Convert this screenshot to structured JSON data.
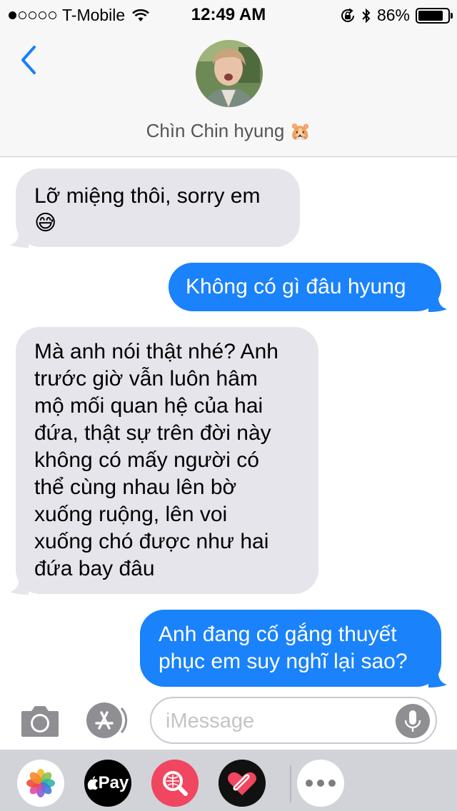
{
  "status_bar": {
    "carrier": "T-Mobile",
    "time": "12:49 AM",
    "battery": "86%",
    "battery_level": 0.86,
    "signal_bars": 1
  },
  "header": {
    "back_icon": "chevron-left-icon",
    "contact_name": "Chìn Chin hyung",
    "contact_emoji": "🐹"
  },
  "messages": [
    {
      "from": "incoming",
      "text": "Lỡ miệng thôi, sorry em",
      "emoji": "😅"
    },
    {
      "from": "outgoing",
      "text": "Không có gì đâu hyung"
    },
    {
      "from": "incoming",
      "lines": [
        "Mà anh nói thật nhé? Anh",
        "trước giờ vẫn luôn hâm",
        "mộ mối quan hệ của hai",
        "đứa, thật sự trên đời này",
        "không có mấy người có",
        "thể cùng nhau lên bờ",
        "xuống ruộng, lên voi",
        "xuống chó được như hai",
        "đứa bay đâu"
      ]
    },
    {
      "from": "outgoing",
      "lines": [
        "Anh đang cố gắng thuyết",
        "phục em suy nghĩ lại sao?"
      ]
    }
  ],
  "input": {
    "placeholder": "iMessage"
  },
  "apps": {
    "pay_label": "Pay",
    "icons": [
      "photos-icon",
      "apple-pay-icon",
      "image-search-icon",
      "heart-digital-touch-icon",
      "more-icon"
    ]
  },
  "colors": {
    "outgoing_bubble": "#1a82fb",
    "incoming_bubble": "#e6e5eb",
    "accent": "#1a7efb"
  }
}
